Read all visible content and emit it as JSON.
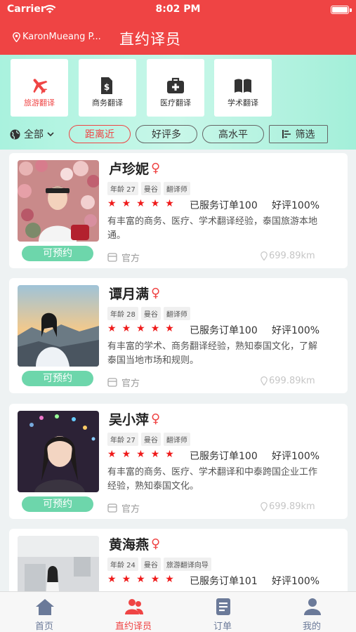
{
  "status": {
    "carrier": "Carrier",
    "time": "8:02 PM"
  },
  "nav": {
    "location": "KaronMueang P...",
    "title": "直约译员"
  },
  "categories": [
    {
      "label": "旅游翻译",
      "icon": "airplane-icon",
      "active": true
    },
    {
      "label": "商务翻译",
      "icon": "dollar-document-icon",
      "active": false
    },
    {
      "label": "医疗翻译",
      "icon": "medical-kit-icon",
      "active": false
    },
    {
      "label": "学术翻译",
      "icon": "book-icon",
      "active": false
    }
  ],
  "filters": {
    "region": "全部",
    "sorts": [
      "距离近",
      "好评多",
      "高水平"
    ],
    "active_sort": "距离近",
    "filter_label": "筛选"
  },
  "translators": [
    {
      "name": "卢珍妮",
      "tags": [
        "年龄 27",
        "曼谷",
        "翻译师"
      ],
      "orders": "已服务订单100",
      "rating": "好评100%",
      "desc": "有丰富的商务、医疗、学术翻译经验，泰国旅游本地通。",
      "status": "可预约",
      "source": "官方",
      "distance": "699.89km",
      "stars": 5
    },
    {
      "name": "谭月满",
      "tags": [
        "年龄 28",
        "曼谷",
        "翻译师"
      ],
      "orders": "已服务订单100",
      "rating": "好评100%",
      "desc": "有丰富的学术、商务翻译经验，熟知泰国文化，了解泰国当地市场和规则。",
      "status": "可预约",
      "source": "官方",
      "distance": "699.89km",
      "stars": 5
    },
    {
      "name": "吴小萍",
      "tags": [
        "年龄 27",
        "曼谷",
        "翻译师"
      ],
      "orders": "已服务订单100",
      "rating": "好评100%",
      "desc": "有丰富的商务、医疗、学术翻译和中泰跨国企业工作经验，熟知泰国文化。",
      "status": "可预约",
      "source": "官方",
      "distance": "699.89km",
      "stars": 5
    },
    {
      "name": "黄海燕",
      "tags": [
        "年龄 24",
        "曼谷",
        "旅游翻译向导"
      ],
      "orders": "已服务订单101",
      "rating": "好评100%",
      "desc": "",
      "status": "",
      "source": "",
      "distance": "",
      "stars": 5
    }
  ],
  "tabs": [
    {
      "label": "首页",
      "icon": "home-icon",
      "active": false
    },
    {
      "label": "直约译员",
      "icon": "translators-icon",
      "active": true
    },
    {
      "label": "订单",
      "icon": "orders-icon",
      "active": false
    },
    {
      "label": "我的",
      "icon": "profile-icon",
      "active": false
    }
  ],
  "colors": {
    "accent": "#ef4444",
    "mint": "#a9f2de",
    "available": "#6dd6ab",
    "tab_inactive": "#6b7a99"
  }
}
